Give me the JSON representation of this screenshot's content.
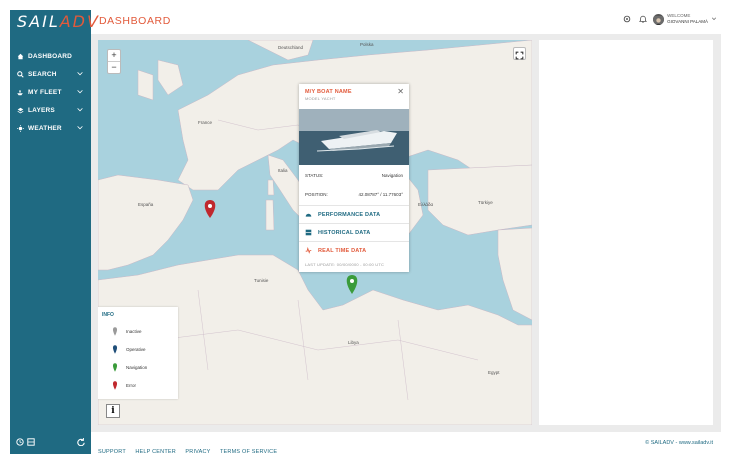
{
  "brand": {
    "logo_main": "SAIL",
    "logo_accent": "ADV"
  },
  "sidebar": {
    "items": [
      {
        "label": "DASHBOARD",
        "icon": "home-icon",
        "has_chevron": false
      },
      {
        "label": "SEARCH",
        "icon": "search-icon",
        "has_chevron": true
      },
      {
        "label": "MY FLEET",
        "icon": "ship-icon",
        "has_chevron": true
      },
      {
        "label": "LAYERS",
        "icon": "layers-icon",
        "has_chevron": true
      },
      {
        "label": "WEATHER",
        "icon": "weather-icon",
        "has_chevron": true
      }
    ]
  },
  "header": {
    "title": "DASHBOARD",
    "welcome": "WELCOME",
    "user_name": "GIOVANNI PALAMÀ"
  },
  "popup": {
    "boat_name": "M/Y BOAT NAME",
    "model": "MODEL YACHT",
    "status_label": "STATUS:",
    "status_value": "Navigation",
    "position_label": "POSITION:",
    "position_value": "42.08787° / 11.77603°",
    "links": [
      {
        "label": "PERFORMANCE DATA",
        "icon": "gauge-icon"
      },
      {
        "label": "HISTORICAL DATA",
        "icon": "table-icon"
      },
      {
        "label": "REAL TIME DATA",
        "icon": "realtime-icon"
      }
    ],
    "last_update": "LAST UPDATE: 00/00/0000 - 00:00 UTC"
  },
  "info": {
    "title": "INFO",
    "legend": [
      {
        "label": "Inactive",
        "color": "#9a9a9a"
      },
      {
        "label": "Operative",
        "color": "#1f4e79"
      },
      {
        "label": "Navigation",
        "color": "#3a9b3a"
      },
      {
        "label": "Error",
        "color": "#c0282e"
      }
    ]
  },
  "map_labels": [
    "Deutschland",
    "Polska",
    "France",
    "Italia",
    "España",
    "Tunisie",
    "Libya",
    "Ελλάδα",
    "Türkiye",
    "Egypt"
  ],
  "footer": {
    "links": [
      "SUPPORT",
      "HELP CENTER",
      "PRIVACY",
      "TERMS OF SERVICE"
    ],
    "copyright": "© SAILADV - www.sailadv.it"
  },
  "colors": {
    "accent": "#e25a3b",
    "sidebar": "#1f6a82",
    "sea": "#a9d2de",
    "land": "#f2efe9"
  }
}
